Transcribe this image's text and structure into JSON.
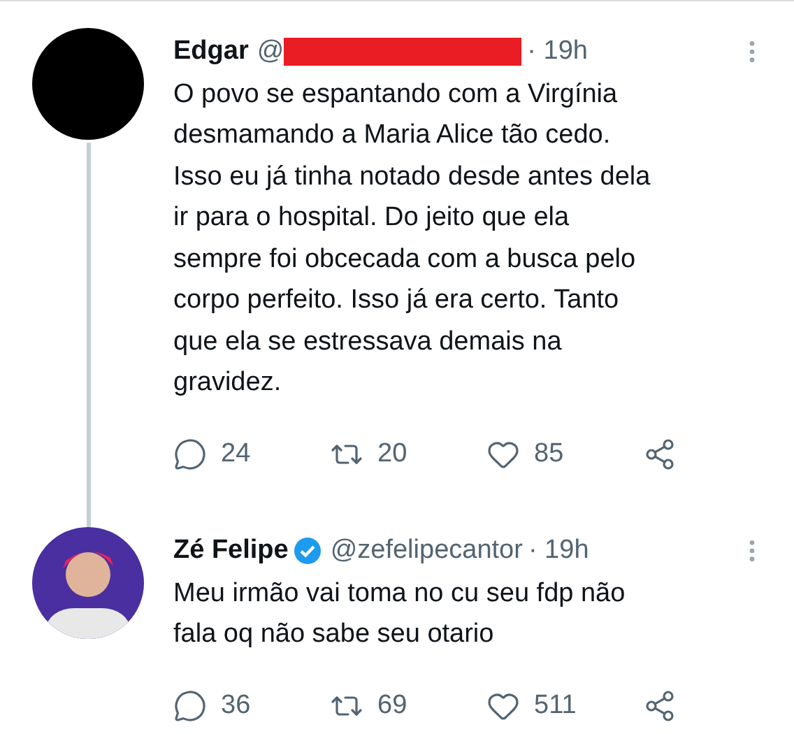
{
  "tweets": [
    {
      "name": "Edgar",
      "handle": "@",
      "handle_redacted": true,
      "verified": false,
      "time": "· 19h",
      "avatar": {
        "kind": "dark"
      },
      "thread_line": true,
      "lines": [
        "O povo se espantando com a Virgínia",
        "desmamando a Maria Alice tão cedo.",
        "Isso eu já tinha notado desde antes dela",
        "ir para o hospital. Do jeito que ela",
        "sempre foi obcecada com a busca pelo",
        "corpo perfeito. Isso já era certo. Tanto",
        "que ela se estressava demais na",
        "gravidez."
      ],
      "replies": "24",
      "retweets": "20",
      "likes": "85"
    },
    {
      "name": "Zé Felipe",
      "handle": "@zefelipecantor",
      "handle_redacted": false,
      "verified": true,
      "time": "· 19h",
      "avatar": {
        "kind": "person"
      },
      "thread_line": false,
      "lines": [
        "Meu irmão vai toma no cu seu fdp não",
        "fala oq não sabe seu otario"
      ],
      "replies": "36",
      "retweets": "69",
      "likes": "511"
    }
  ]
}
